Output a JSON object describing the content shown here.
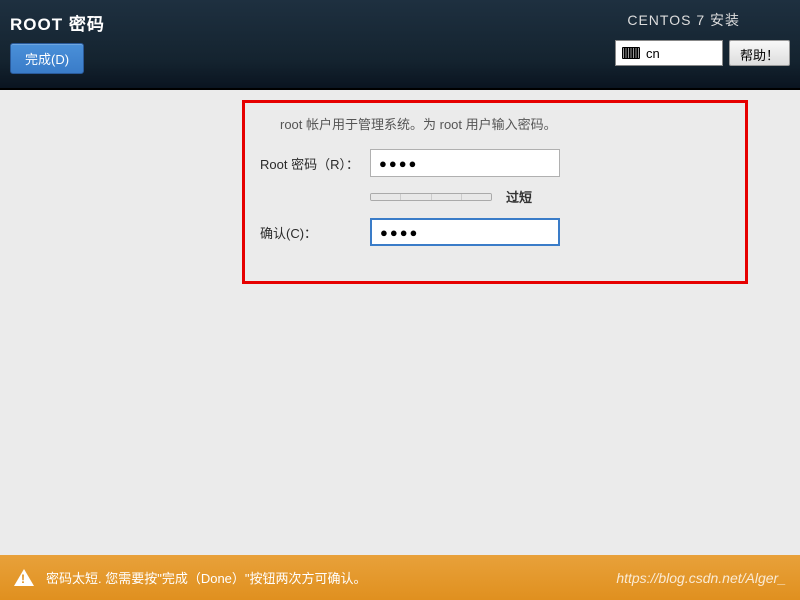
{
  "header": {
    "page_title": "ROOT 密码",
    "done_button": "完成(D)",
    "installer_title": "CENTOS 7 安装",
    "language_code": "cn",
    "help_button": "帮助！"
  },
  "form": {
    "instruction": "root 帐户用于管理系统。为 root 用户输入密码。",
    "root_password_label": "Root 密码（R）：",
    "root_password_value": "●●●●",
    "strength_label": "过短",
    "confirm_label": "确认(C)：",
    "confirm_value": "●●●●"
  },
  "footer": {
    "warning_message": "密码太短. 您需要按\"完成（Done）\"按钮两次方可确认。",
    "watermark": "https://blog.csdn.net/Alger_"
  }
}
